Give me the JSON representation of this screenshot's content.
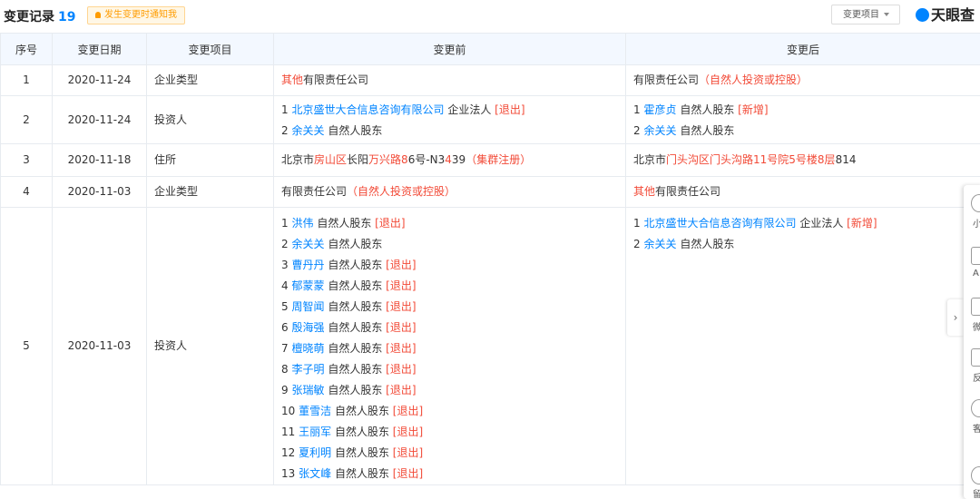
{
  "header": {
    "title": "变更记录",
    "count": "19",
    "notify_label": "发生变更时通知我",
    "filter_label": "变更项目",
    "brand_prefix": "天眼查"
  },
  "table": {
    "columns": [
      "序号",
      "变更日期",
      "变更项目",
      "变更前",
      "变更后"
    ],
    "rows": [
      {
        "index": "1",
        "date": "2020-11-24",
        "item": "企业类型",
        "before": [
          {
            "prefix": "",
            "hl": "其他",
            "rest": "有限责任公司"
          }
        ],
        "after": [
          {
            "prefix": "",
            "hl": "",
            "rest": "有限责任公司",
            "tail": "（自然人投资或控股）"
          }
        ]
      },
      {
        "index": "2",
        "date": "2020-11-24",
        "item": "投资人",
        "before": [
          {
            "num": "1",
            "name": "北京盛世大合信息咨询有限公司",
            "type": "企业法人",
            "tag": "[退出]"
          },
          {
            "num": "2",
            "name": "余关关",
            "type": "自然人股东",
            "tag": ""
          }
        ],
        "after": [
          {
            "num": "1",
            "name": "霍彦贞",
            "type": "自然人股东",
            "tag": "[新增]"
          },
          {
            "num": "2",
            "name": "余关关",
            "type": "自然人股东",
            "tag": ""
          }
        ]
      },
      {
        "index": "3",
        "date": "2020-11-18",
        "item": "住所",
        "before_parts": [
          "北京市",
          "房山区",
          "长阳",
          "万兴路8",
          "6号-N3",
          "4",
          "39",
          "（集群注册）"
        ],
        "after_parts": [
          "北京市",
          "门头沟区门头沟路11号院5号楼8层",
          "814"
        ]
      },
      {
        "index": "4",
        "date": "2020-11-03",
        "item": "企业类型",
        "before": [
          {
            "rest": "有限责任公司",
            "tail": "（自然人投资或控股）"
          }
        ],
        "after": [
          {
            "hl": "其他",
            "rest": "有限责任公司"
          }
        ]
      },
      {
        "index": "5",
        "date": "2020-11-03",
        "item": "投资人",
        "before": [
          {
            "num": "1",
            "name": "洪伟",
            "type": "自然人股东",
            "tag": "[退出]"
          },
          {
            "num": "2",
            "name": "余关关",
            "type": "自然人股东",
            "tag": ""
          },
          {
            "num": "3",
            "name": "曹丹丹",
            "type": "自然人股东",
            "tag": "[退出]"
          },
          {
            "num": "4",
            "name": "郁蒙蒙",
            "type": "自然人股东",
            "tag": "[退出]"
          },
          {
            "num": "5",
            "name": "周智闻",
            "type": "自然人股东",
            "tag": "[退出]"
          },
          {
            "num": "6",
            "name": "殷海强",
            "type": "自然人股东",
            "tag": "[退出]"
          },
          {
            "num": "7",
            "name": "檀晓萌",
            "type": "自然人股东",
            "tag": "[退出]"
          },
          {
            "num": "8",
            "name": "李子明",
            "type": "自然人股东",
            "tag": "[退出]"
          },
          {
            "num": "9",
            "name": "张瑞敏",
            "type": "自然人股东",
            "tag": "[退出]"
          },
          {
            "num": "10",
            "name": "董雪洁",
            "type": "自然人股东",
            "tag": "[退出]"
          },
          {
            "num": "11",
            "name": "王丽军",
            "type": "自然人股东",
            "tag": "[退出]"
          },
          {
            "num": "12",
            "name": "夏利明",
            "type": "自然人股东",
            "tag": "[退出]"
          },
          {
            "num": "13",
            "name": "张文峰",
            "type": "自然人股东",
            "tag": "[退出]"
          }
        ],
        "after": [
          {
            "num": "1",
            "name": "北京盛世大合信息咨询有限公司",
            "type": "企业法人",
            "tag": "[新增]"
          },
          {
            "num": "2",
            "name": "余关关",
            "type": "自然人股东",
            "tag": ""
          }
        ]
      }
    ]
  },
  "sidebar": {
    "labels": [
      "小",
      "A",
      "微",
      "反",
      "客",
      "留"
    ]
  }
}
